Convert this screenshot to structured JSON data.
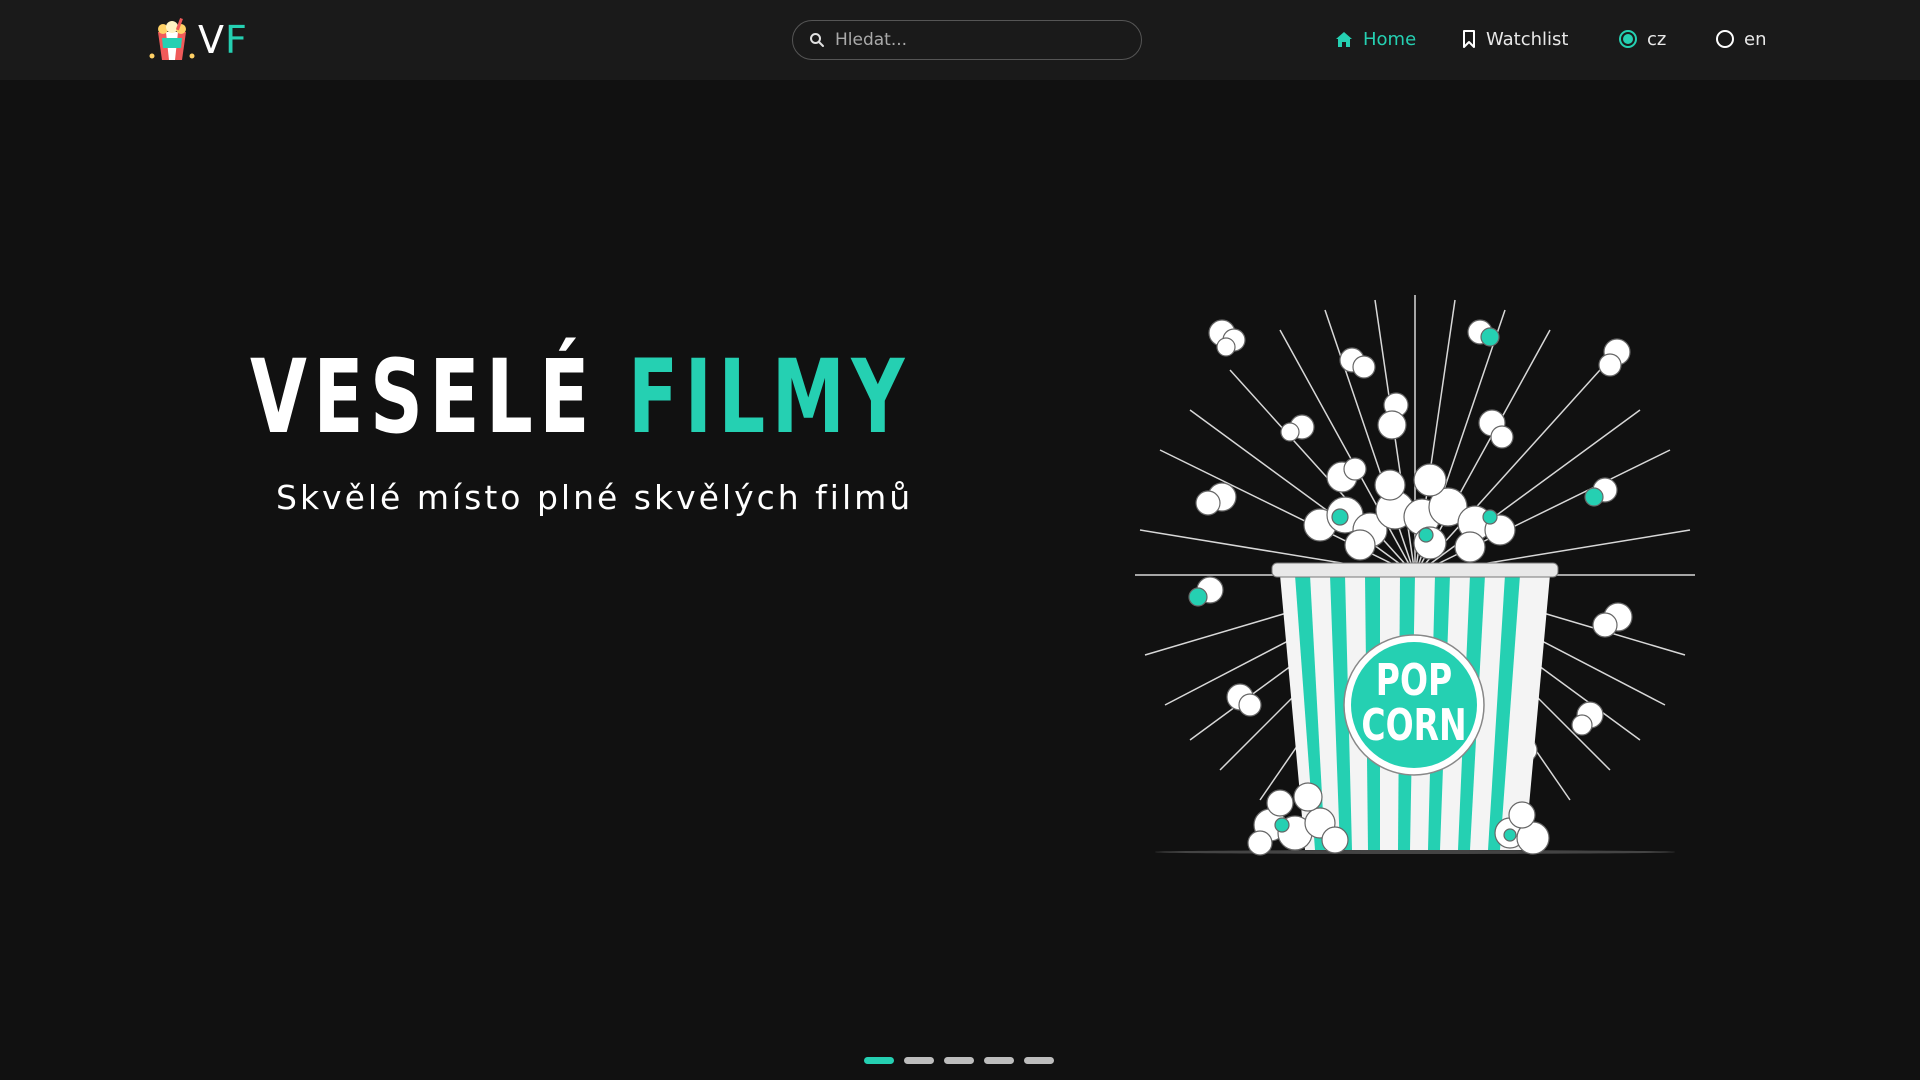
{
  "brand": {
    "letter_v": "V",
    "letter_f": "F"
  },
  "search": {
    "placeholder": "Hledat..."
  },
  "nav": {
    "home": "Home",
    "watchlist": "Watchlist",
    "lang_cz": "cz",
    "lang_en": "en",
    "selected_lang": "cz"
  },
  "hero": {
    "title_white": "VESELÉ",
    "title_teal": "FILMY",
    "subtitle": "Skvělé místo plné skvělých filmů",
    "cup_line1": "POP",
    "cup_line2": "CORN"
  },
  "carousel": {
    "slides": 5,
    "active_index": 0
  },
  "colors": {
    "accent": "#25d0b2",
    "background": "#111111",
    "navbar": "#1a1a1a"
  },
  "icons": [
    "logo-popcorn-icon",
    "search-icon",
    "home-icon",
    "bookmark-icon"
  ]
}
